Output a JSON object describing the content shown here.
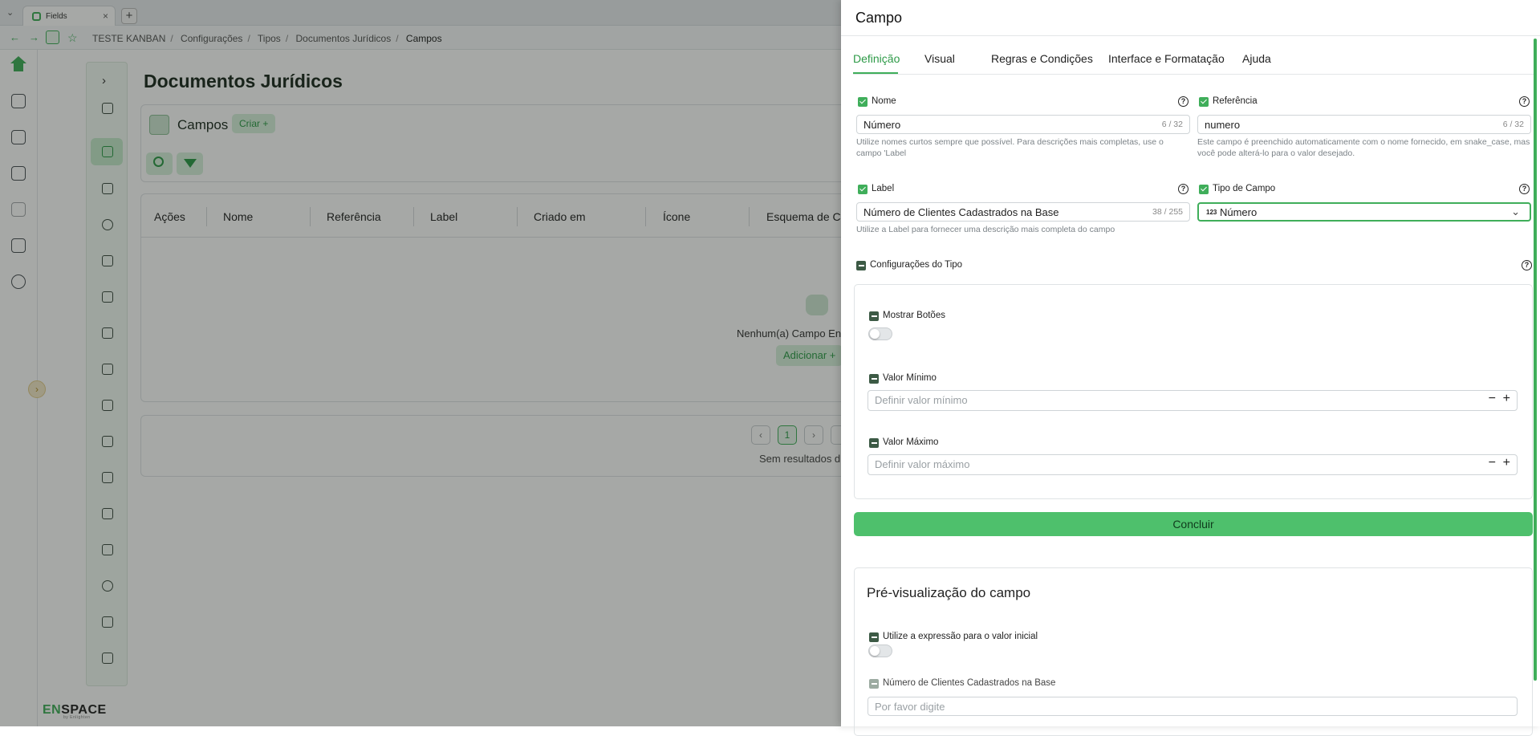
{
  "browser": {
    "tab_title": "Fields",
    "new_tab": "+",
    "close": "×",
    "breadcrumbs": [
      "TESTE KANBAN",
      "Configurações",
      "Tipos",
      "Documentos Jurídicos",
      "Campos"
    ]
  },
  "brand": {
    "logo_prefix": "EN",
    "logo_suffix": "SPACE",
    "logo_sub": "by Enlighten",
    "accent": "#3fae5a"
  },
  "page": {
    "title": "Documentos Jurídicos",
    "section_title": "Campos",
    "create_label": "Criar +",
    "columns": [
      "Ações",
      "Nome",
      "Referência",
      "Label",
      "Criado em",
      "Ícone",
      "Esquema de C..."
    ],
    "empty_text": "Nenhum(a) Campo Enc",
    "add_label": "Adicionar +",
    "current_page": "1",
    "no_results": "Sem resultados d"
  },
  "drawer": {
    "title": "Campo",
    "tabs": [
      "Definição",
      "Visual",
      "Regras e Condições",
      "Interface e Formatação",
      "Ajuda"
    ],
    "active_tab": "Definição",
    "nome": {
      "label": "Nome",
      "value": "Número",
      "count": "6 / 32",
      "hint": "Utilize nomes curtos sempre que possível. Para descrições mais completas, use o campo 'Label"
    },
    "referencia": {
      "label": "Referência",
      "value": "numero",
      "count": "6 / 32",
      "hint": "Este campo é preenchido automaticamente com o nome fornecido, em snake_case, mas você pode alterá-lo para o valor desejado."
    },
    "label": {
      "label": "Label",
      "value": "Número de Clientes Cadastrados na Base",
      "count": "38 / 255",
      "hint": "Utilize a Label para fornecer uma descrição mais completa do campo"
    },
    "tipo": {
      "label": "Tipo de Campo",
      "value": "Número",
      "icon_text": "123"
    },
    "config": {
      "title": "Configurações do Tipo",
      "mostrar_botoes": "Mostrar Botões",
      "valor_minimo": "Valor Mínimo",
      "valor_minimo_placeholder": "Definir valor mínimo",
      "valor_maximo": "Valor Máximo",
      "valor_maximo_placeholder": "Definir valor máximo",
      "minus": "−",
      "plus": "+"
    },
    "concluir": "Concluir",
    "preview": {
      "title": "Pré-visualização do campo",
      "expressao": "Utilize a expressão para o valor inicial",
      "field_label": "Número de Clientes Cadastrados na Base",
      "placeholder": "Por favor digite"
    },
    "help_glyph": "?"
  }
}
